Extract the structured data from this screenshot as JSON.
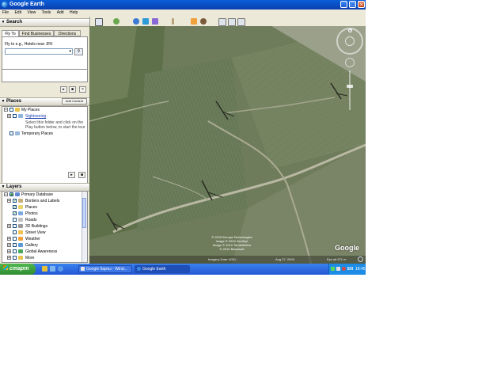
{
  "window": {
    "title": "Google Earth",
    "buttons": [
      "minimize",
      "maximize",
      "close"
    ]
  },
  "menubar": {
    "items": [
      "File",
      "Edit",
      "View",
      "Tools",
      "Add",
      "Help"
    ]
  },
  "search": {
    "header": "Search",
    "tabs": [
      "Fly To",
      "Find Businesses",
      "Directions"
    ],
    "fly_to_label": "Fly to e.g., Hotels near JFK"
  },
  "places": {
    "header": "Places",
    "add_content": "Add Content",
    "items": [
      {
        "label": "My Places"
      },
      {
        "label": "Sightseeing"
      },
      {
        "label": "Select this folder and click on the"
      },
      {
        "label": "Play button below, to start the tour"
      },
      {
        "label": "Temporary Places"
      }
    ]
  },
  "layers": {
    "header": "Layers",
    "items": [
      {
        "label": "Primary Database"
      },
      {
        "label": "Borders and Labels"
      },
      {
        "label": "Places"
      },
      {
        "label": "Photos"
      },
      {
        "label": "Roads"
      },
      {
        "label": "3D Buildings"
      },
      {
        "label": "Street View"
      },
      {
        "label": "Weather"
      },
      {
        "label": "Gallery"
      },
      {
        "label": "Global Awareness"
      },
      {
        "label": "More"
      }
    ]
  },
  "map": {
    "copyright": [
      "© 2010 Europa Technologies",
      "Image © 2010 GeoEye",
      "Image © 2010 TerraMetrics",
      "© 2010 Basarsoft"
    ],
    "brand": "Google",
    "status_left": "Imagery Date: 8/31/...",
    "status_mid": "Aug 27, 2009",
    "status_right": "Eye alt 971 m"
  },
  "taskbar": {
    "start": "старт",
    "items": [
      "Google Карты - Wind...",
      "Google Earth"
    ],
    "lang": "EN",
    "clock": "18:45"
  },
  "colors": {
    "titlebar": "#0a4fc9",
    "taskbar": "#2a5fdb",
    "start": "#3a9a3a",
    "map_base": "#6e7a5a"
  }
}
